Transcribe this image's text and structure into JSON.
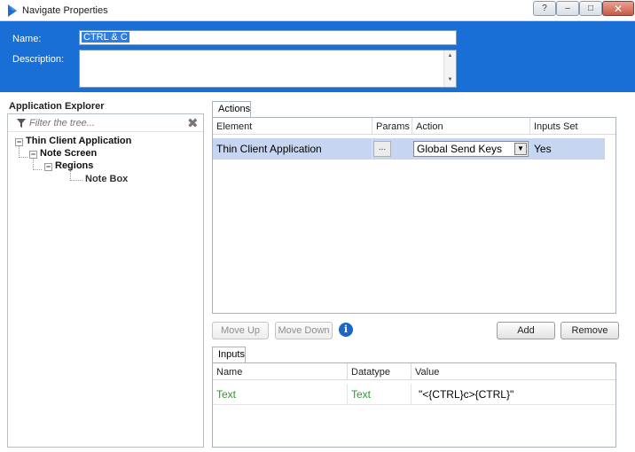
{
  "window": {
    "title": "Navigate Properties",
    "help": "?",
    "minimize": "–",
    "maximize": "□",
    "close": "✕"
  },
  "header": {
    "name_label": "Name:",
    "name_value": "CTRL & C",
    "description_label": "Description:",
    "description_value": "",
    "scroll_up": "▲",
    "scroll_down": "▼"
  },
  "explorer": {
    "title": "Application Explorer",
    "filter_placeholder": "Filter the tree...",
    "clear": "✖",
    "nodes": [
      {
        "label": "Thin Client Application",
        "expander": "−"
      },
      {
        "label": "Note Screen",
        "expander": "−"
      },
      {
        "label": "Regions",
        "expander": "−"
      },
      {
        "label": "Note Box"
      }
    ]
  },
  "actions": {
    "tab": "Actions",
    "columns": [
      "Element",
      "Params",
      "Action",
      "Inputs Set"
    ],
    "rows": [
      {
        "element": "Thin Client Application",
        "params": "...",
        "action": "Global Send Keys",
        "inputs_set": "Yes"
      }
    ],
    "dropdown_arrow": "▼"
  },
  "buttons": {
    "move_up": "Move Up",
    "move_down": "Move Down",
    "info": "i",
    "add": "Add",
    "remove": "Remove"
  },
  "inputs": {
    "tab": "Inputs",
    "columns": [
      "Name",
      "Datatype",
      "Value"
    ],
    "rows": [
      {
        "name": "Text",
        "datatype": "Text",
        "value": "\"<{CTRL}c>{CTRL}\""
      }
    ]
  },
  "colors": {
    "header_blue": "#1a6fd6",
    "selection": "#c6d6f0",
    "type_green": "#2a9a2a",
    "info_blue": "#1a66c9"
  }
}
